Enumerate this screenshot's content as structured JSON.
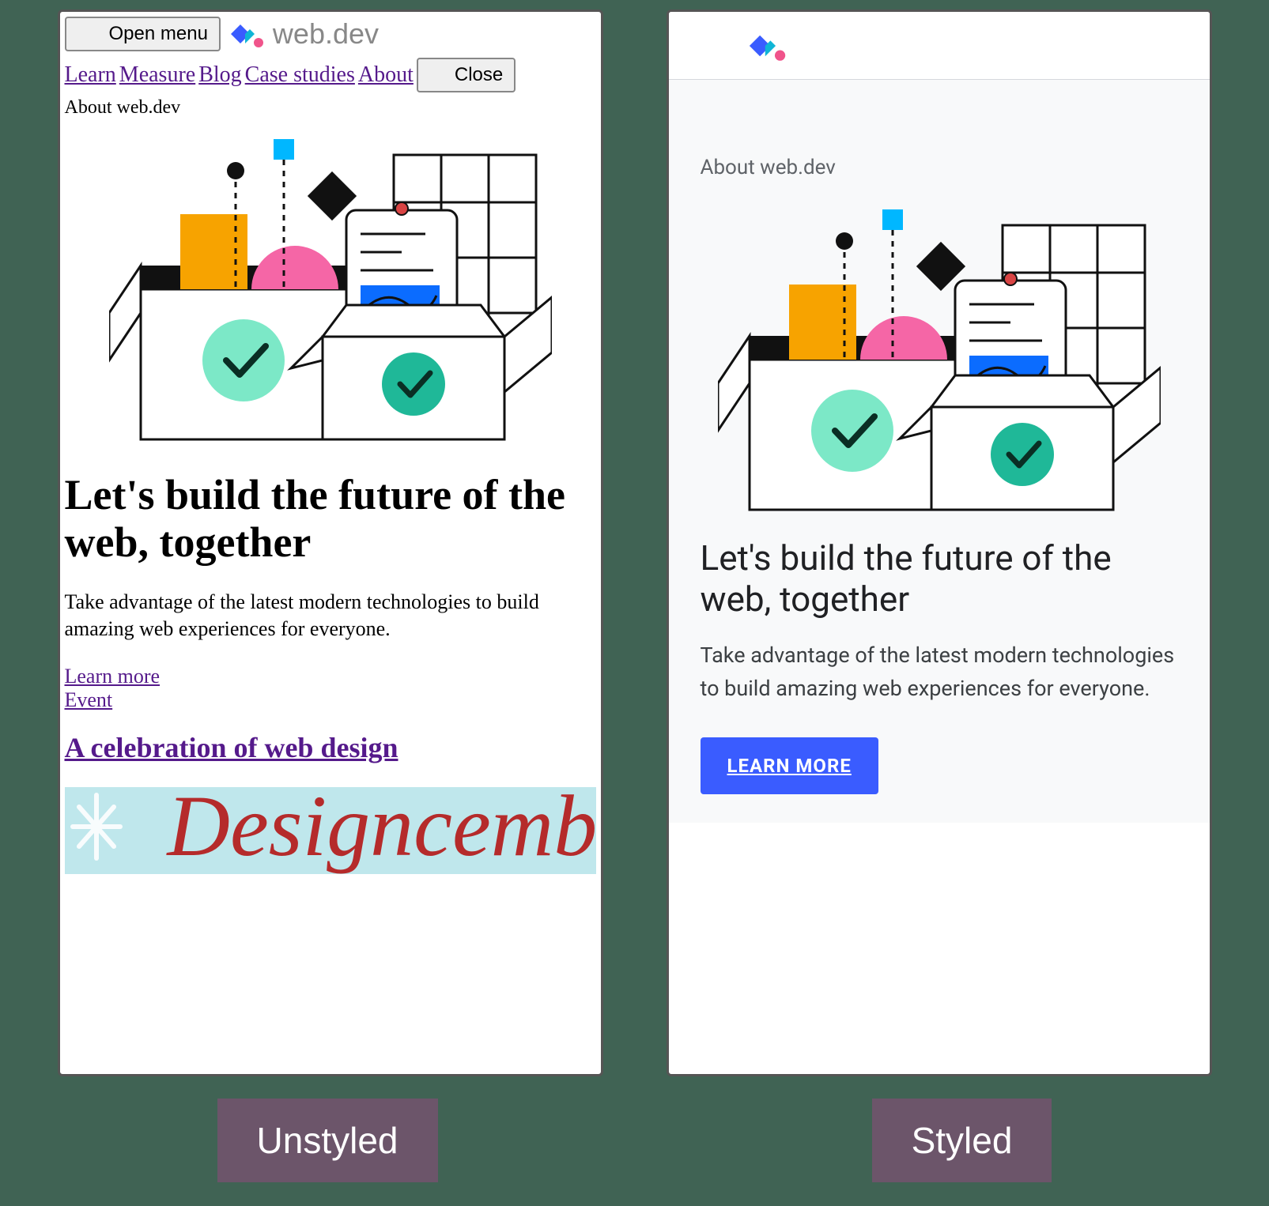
{
  "captions": {
    "left": "Unstyled",
    "right": "Styled"
  },
  "logo_text": "web.dev",
  "unstyled": {
    "open_menu": "Open menu",
    "close": "Close",
    "nav": {
      "learn": "Learn",
      "measure": "Measure",
      "blog": "Blog",
      "case_studies": "Case studies",
      "about": "About"
    },
    "eyebrow": "About web.dev",
    "h1": "Let's build the future of the web, together",
    "p": "Take advantage of the latest modern technologies to build amazing web experiences for everyone.",
    "learn_more": "Learn more",
    "event": "Event",
    "h2": "A celebration of web design"
  },
  "styled": {
    "eyebrow": "About web.dev",
    "h1": "Let's build the future of the web, together",
    "p": "Take advantage of the latest modern technologies to build amazing web experiences for everyone.",
    "cta": "LEARN MORE"
  }
}
